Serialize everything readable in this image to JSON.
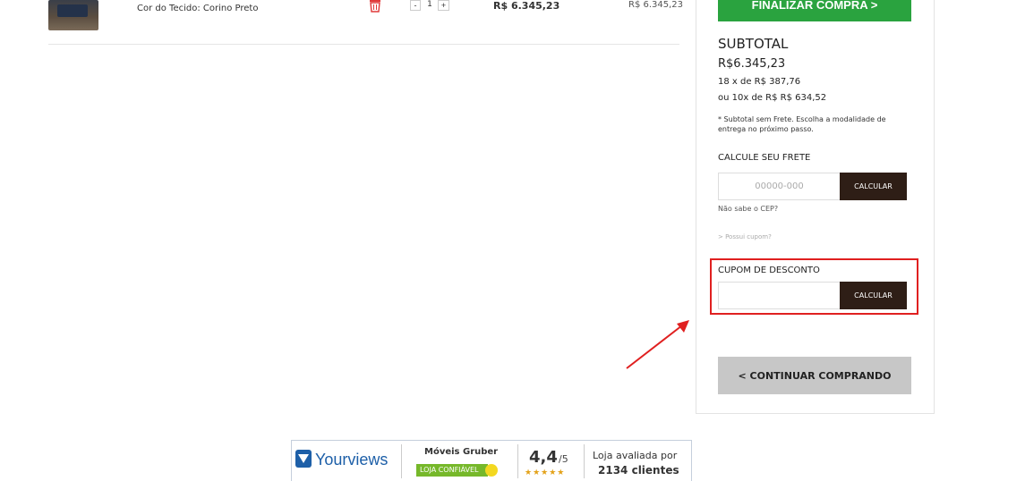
{
  "cart_item": {
    "variant": "Cor do Tecido: Corino Preto",
    "qty_minus": "-",
    "quantity": "1",
    "qty_plus": "+",
    "unit_price": "R$ 6.345,23",
    "total_price": "R$ 6.345,23"
  },
  "summary": {
    "finalize_label": "FINALIZAR COMPRA >",
    "subtotal_title": "SUBTOTAL",
    "subtotal_value": "R$6.345,23",
    "installments_1": "18 x de R$ 387,76",
    "installments_2": "ou 10x de R$ R$ 634,52",
    "note": "* Subtotal sem Frete. Escolha a modalidade de entrega no próximo passo.",
    "shipping_title": "CALCULE SEU FRETE",
    "cep_placeholder": "00000-000",
    "calc_label": "CALCULAR",
    "cep_link": "Não sabe o CEP?",
    "coupon_link": "> Possui cupom?",
    "coupon_title": "CUPOM DE DESCONTO",
    "coupon_calc_label": "CALCULAR",
    "continue_label": "< CONTINUAR COMPRANDO"
  },
  "badge": {
    "brand": "Yourviews",
    "store": "Móveis Gruber",
    "trust": "LOJA CONFIÁVEL",
    "score": "4,4",
    "score_max": "/5",
    "stars": "★★★★★",
    "rated_line1": "Loja avaliada por",
    "rated_line2": "2134 clientes"
  },
  "colors": {
    "finalize_green": "#2aa33f",
    "calc_dark": "#2e1e16",
    "highlight_red": "#e02020",
    "continue_gray": "#c7c7c7",
    "yourviews_blue": "#1d5fa8"
  },
  "icons": {
    "trash": "trash-icon",
    "arrow": "red-arrow-annotation"
  }
}
